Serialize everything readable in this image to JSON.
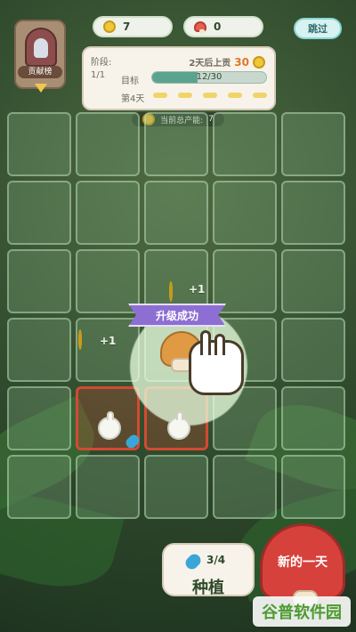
{
  "top": {
    "sun_count": "7",
    "mushroom_count": "0",
    "skip_label": "跳过"
  },
  "badge": {
    "label": "贡献榜"
  },
  "panel": {
    "stage_label": "阶段:",
    "stage_value": "1/1",
    "due_text": "2天后上贡",
    "due_number": "30",
    "goal_label": "目标",
    "progress_text": "12/30",
    "progress_fraction": 0.4,
    "day_label": "第4天"
  },
  "total": {
    "label": "当前总产能:",
    "value": "7"
  },
  "grid": {
    "rows": 6,
    "cols": 5
  },
  "effects": {
    "plus_one_a": "+1",
    "plus_one_b": "+1",
    "upgrade_text": "升级成功"
  },
  "bottom": {
    "plant_count": "3/4",
    "plant_label": "种植",
    "newday_label": "新的一天",
    "watermark": "谷普软件园"
  },
  "icons": {
    "sun": "sun-icon",
    "mushroom": "mushroom-icon",
    "door": "door-icon",
    "drop": "water-drop-icon",
    "hand": "hand-pointer-icon"
  },
  "colors": {
    "accent_orange": "#e0782b",
    "progress": "#5aa48f",
    "red_cell": "#d24a33",
    "purple_banner": "#8d6fd3"
  }
}
